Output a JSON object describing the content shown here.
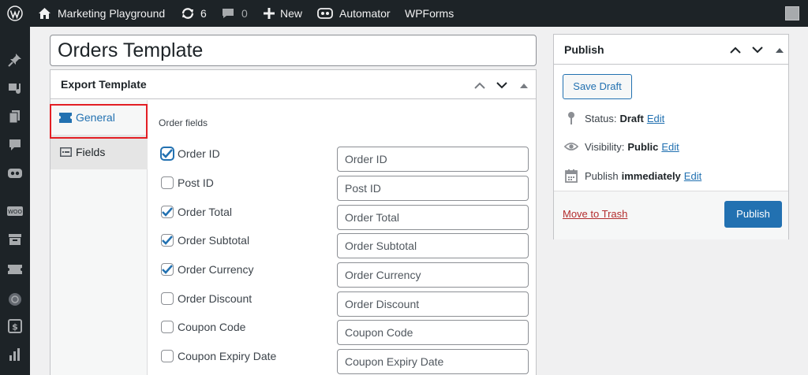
{
  "admin_bar": {
    "site_name": "Marketing Playground",
    "updates_count": "6",
    "comments_count": "0",
    "new_label": "New",
    "automator_label": "Automator",
    "wpforms_label": "WPForms"
  },
  "sidebar_icons": [
    "pin-icon",
    "media-icon",
    "pages-icon",
    "comments-icon",
    "automator-icon",
    "woo-icon",
    "archive-icon",
    "ticket-icon",
    "circle-icon",
    "dollar-icon",
    "chart-icon"
  ],
  "post": {
    "title": "Orders Template"
  },
  "export_template": {
    "heading": "Export Template",
    "tabs": [
      {
        "label": "General",
        "icon": "ticket-icon"
      },
      {
        "label": "Fields",
        "icon": "fields-icon"
      }
    ],
    "section_label": "Order fields",
    "fields": [
      {
        "label": "Order ID",
        "checked": true,
        "value": "Order ID"
      },
      {
        "label": "Post ID",
        "checked": false,
        "value": "Post ID"
      },
      {
        "label": "Order Total",
        "checked": true,
        "value": "Order Total"
      },
      {
        "label": "Order Subtotal",
        "checked": true,
        "value": "Order Subtotal"
      },
      {
        "label": "Order Currency",
        "checked": true,
        "value": "Order Currency"
      },
      {
        "label": "Order Discount",
        "checked": false,
        "value": "Order Discount"
      },
      {
        "label": "Coupon Code",
        "checked": false,
        "value": "Coupon Code"
      },
      {
        "label": "Coupon Expiry Date",
        "checked": false,
        "value": "Coupon Expiry Date"
      }
    ]
  },
  "publish": {
    "heading": "Publish",
    "save_draft": "Save Draft",
    "status_label": "Status:",
    "status_value": "Draft",
    "visibility_label": "Visibility:",
    "visibility_value": "Public",
    "publish_label": "Publish",
    "publish_value": "immediately",
    "edit_label": "Edit",
    "trash_label": "Move to Trash",
    "publish_button": "Publish"
  },
  "colors": {
    "admin_bar_bg": "#1d2327",
    "accent": "#2271b1",
    "highlight_border": "#e31e24",
    "trash": "#b32d2e"
  }
}
